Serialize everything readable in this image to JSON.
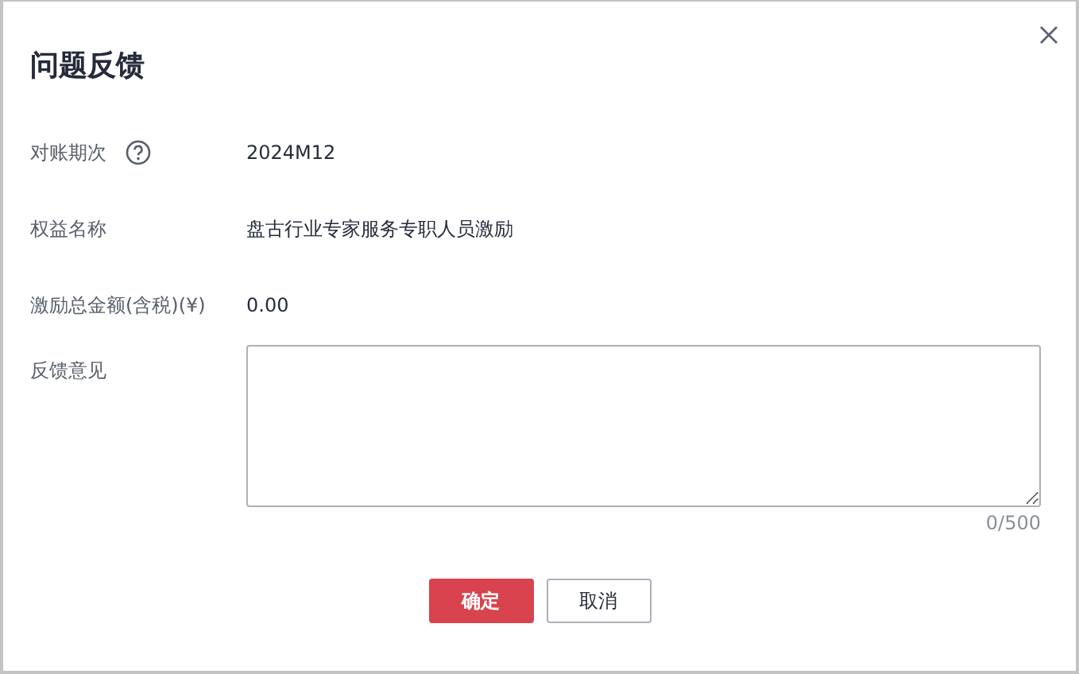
{
  "dialog": {
    "title": "问题反馈"
  },
  "fields": [
    {
      "label": "对账期次",
      "help": true,
      "value": "2024M12"
    },
    {
      "label": "权益名称",
      "help": false,
      "value": "盘古行业专家服务专职人员激励"
    },
    {
      "label": "激励总金额(含税)(¥)",
      "help": false,
      "value": "0.00"
    }
  ],
  "feedback": {
    "label": "反馈意见",
    "counter": "0/500"
  },
  "buttons": [
    {
      "label": "确定",
      "kind": "primary"
    },
    {
      "label": "取消",
      "kind": "secondary"
    }
  ]
}
